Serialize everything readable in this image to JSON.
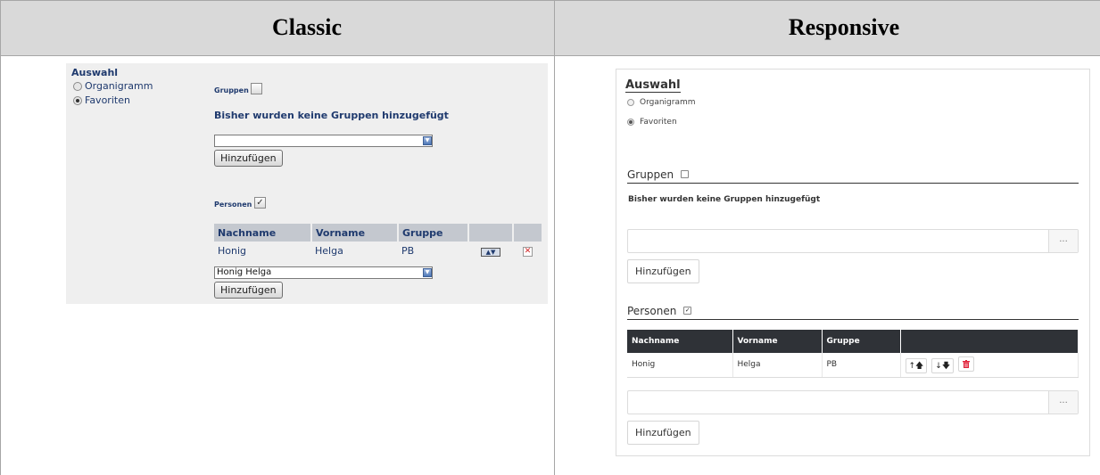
{
  "comparison": {
    "classic_title": "Classic",
    "responsive_title": "Responsive"
  },
  "classic": {
    "auswahl_label": "Auswahl",
    "radio_options": [
      "Organigramm",
      "Favoriten"
    ],
    "selected_option": "Favoriten",
    "gruppen_label": "Gruppen",
    "gruppen_checked": false,
    "no_groups_message": "Bisher wurden keine Gruppen hinzugefügt",
    "groups_select_value": "",
    "groups_add_button": "Hinzufügen",
    "personen_label": "Personen",
    "personen_checked": true,
    "table_headers": [
      "Nachname",
      "Vorname",
      "Gruppe"
    ],
    "rows": [
      {
        "nachname": "Honig",
        "vorname": "Helga",
        "gruppe": "PB"
      }
    ],
    "persons_select_value": "Honig Helga",
    "persons_add_button": "Hinzufügen",
    "colors": {
      "panel_bg": "#efefef",
      "header_bg": "#c4c8cf",
      "text": "#1f3a6e"
    }
  },
  "responsive": {
    "auswahl_label": "Auswahl",
    "radio_options": [
      "Organigramm",
      "Favoriten"
    ],
    "selected_option": "Favoriten",
    "gruppen_label": "Gruppen",
    "gruppen_checked": false,
    "no_groups_message": "Bisher wurden keine Gruppen hinzugefügt",
    "groups_input_value": "",
    "groups_input_button": "...",
    "groups_add_button": "Hinzufügen",
    "personen_label": "Personen",
    "personen_checked": true,
    "table_headers": [
      "Nachname",
      "Vorname",
      "Gruppe"
    ],
    "rows": [
      {
        "nachname": "Honig",
        "vorname": "Helga",
        "gruppe": "PB"
      }
    ],
    "row_tools": {
      "up": "↑🡅",
      "down": "↓🡇",
      "delete_icon": "trash-icon"
    },
    "persons_input_value": "",
    "persons_input_button": "...",
    "persons_add_button": "Hinzufügen",
    "colors": {
      "table_header_bg": "#2f3237",
      "delete": "#e0233a"
    }
  }
}
